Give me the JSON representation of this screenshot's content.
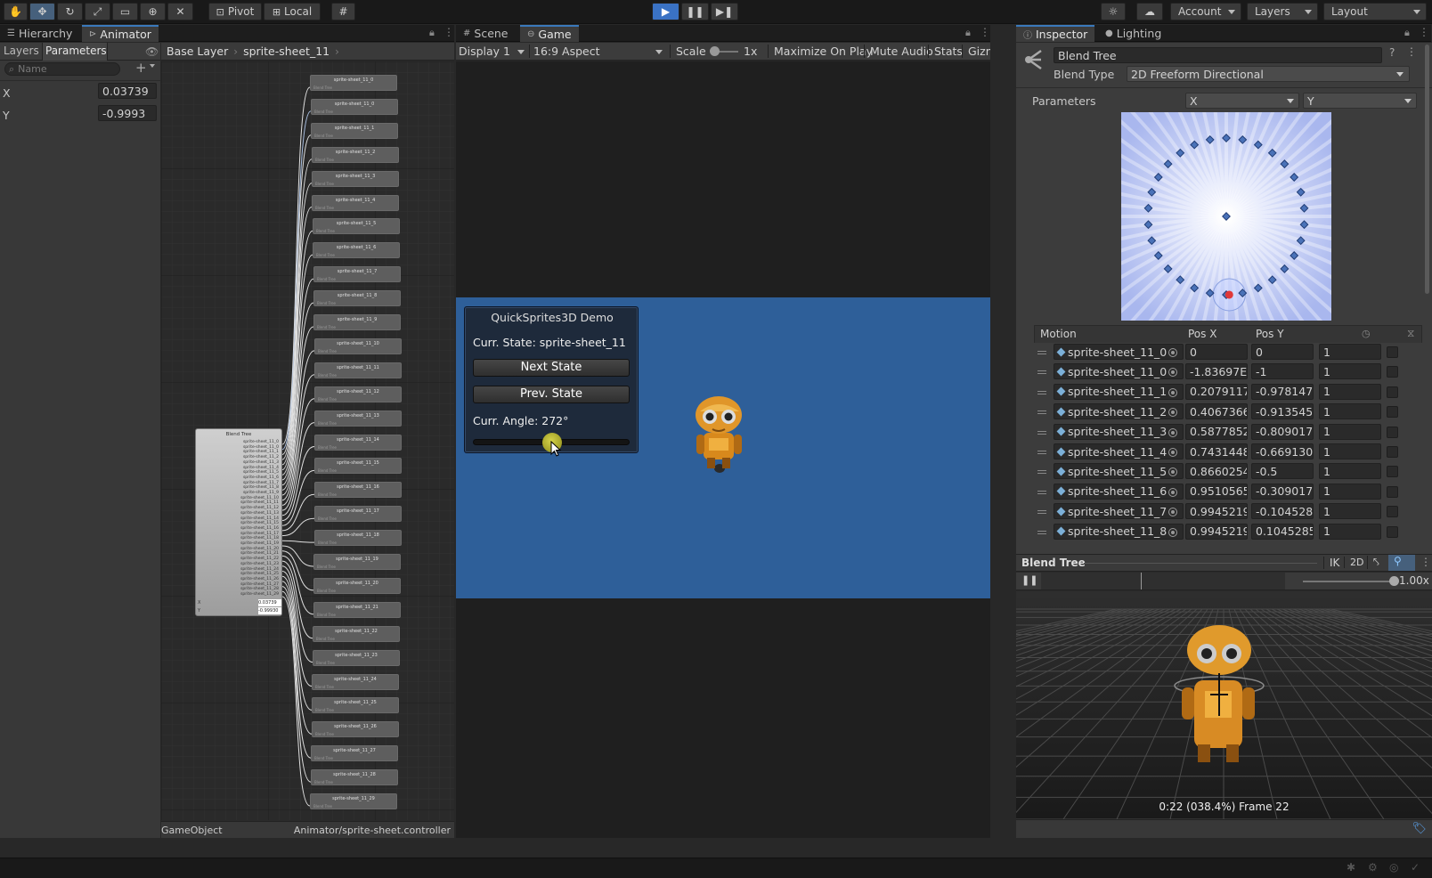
{
  "toolbar": {
    "pivot": "Pivot",
    "local": "Local",
    "account": "Account",
    "layers": "Layers",
    "layout": "Layout"
  },
  "animator": {
    "tabs": [
      "Hierarchy",
      "Animator"
    ],
    "subtabs": [
      "Layers",
      "Parameters"
    ],
    "search_placeholder": "Name",
    "params": [
      {
        "name": "X",
        "value": "0.03739"
      },
      {
        "name": "Y",
        "value": "-0.9993"
      }
    ],
    "breadcrumb": [
      "Base Layer",
      "sprite-sheet_11"
    ],
    "status_left": "GameObject",
    "status_right": "Animator/sprite-sheet.controller",
    "blend_tree_title": "Blend Tree",
    "blend_tree_x_val": "0.03739",
    "blend_tree_y_val": "-0.99930",
    "nodes": [
      "sprite-sheet_11_0",
      "sprite-sheet_11_0",
      "sprite-sheet_11_1",
      "sprite-sheet_11_2",
      "sprite-sheet_11_3",
      "sprite-sheet_11_4",
      "sprite-sheet_11_5",
      "sprite-sheet_11_6",
      "sprite-sheet_11_7",
      "sprite-sheet_11_8",
      "sprite-sheet_11_9",
      "sprite-sheet_11_10",
      "sprite-sheet_11_11",
      "sprite-sheet_11_12",
      "sprite-sheet_11_13",
      "sprite-sheet_11_14",
      "sprite-sheet_11_15",
      "sprite-sheet_11_16",
      "sprite-sheet_11_17",
      "sprite-sheet_11_18",
      "sprite-sheet_11_19",
      "sprite-sheet_11_20",
      "sprite-sheet_11_21",
      "sprite-sheet_11_22",
      "sprite-sheet_11_23",
      "sprite-sheet_11_24",
      "sprite-sheet_11_25",
      "sprite-sheet_11_26",
      "sprite-sheet_11_27",
      "sprite-sheet_11_28",
      "sprite-sheet_11_29"
    ],
    "node_sub": "Blend Tree"
  },
  "game": {
    "tabs": [
      "Scene",
      "Game"
    ],
    "display": "Display 1",
    "aspect": "16:9 Aspect",
    "scale_label": "Scale",
    "scale_value": "1x",
    "maximize": "Maximize On Play",
    "mute": "Mute Audio",
    "stats": "Stats",
    "gizmos": "Gizm",
    "demo_title": "QuickSprites3D Demo",
    "curr_state": "Curr. State: sprite-sheet_11",
    "next_btn": "Next State",
    "prev_btn": "Prev. State",
    "curr_angle": "Curr. Angle: 272°",
    "angle_fraction": 0.5
  },
  "inspector": {
    "tabs": [
      "Inspector",
      "Lighting"
    ],
    "name": "Blend Tree",
    "blend_type_label": "Blend Type",
    "blend_type": "2D Freeform Directional",
    "parameters_label": "Parameters",
    "param_x": "X",
    "param_y": "Y",
    "table_headers": [
      "Motion",
      "Pos X",
      "Pos Y"
    ],
    "motions": [
      {
        "motion": "sprite-sheet_11_0",
        "px": "0",
        "py": "0",
        "t": "1"
      },
      {
        "motion": "sprite-sheet_11_0",
        "px": "-1.83697E-",
        "py": "-1",
        "t": "1"
      },
      {
        "motion": "sprite-sheet_11_1",
        "px": "0.2079117",
        "py": "-0.9781476",
        "t": "1"
      },
      {
        "motion": "sprite-sheet_11_2",
        "px": "0.4067366",
        "py": "-0.9135454",
        "t": "1"
      },
      {
        "motion": "sprite-sheet_11_3",
        "px": "0.5877852",
        "py": "-0.809017",
        "t": "1"
      },
      {
        "motion": "sprite-sheet_11_4",
        "px": "0.7431448",
        "py": "-0.6691306",
        "t": "1"
      },
      {
        "motion": "sprite-sheet_11_5",
        "px": "0.8660254",
        "py": "-0.5",
        "t": "1"
      },
      {
        "motion": "sprite-sheet_11_6",
        "px": "0.9510565",
        "py": "-0.309017",
        "t": "1"
      },
      {
        "motion": "sprite-sheet_11_7",
        "px": "0.9945219",
        "py": "-0.1045285",
        "t": "1"
      },
      {
        "motion": "sprite-sheet_11_8",
        "px": "0.9945219",
        "py": "0.1045285",
        "t": "1"
      }
    ],
    "preview_title": "Blend Tree",
    "ik": "IK",
    "twod": "2D",
    "speed": "1.00x",
    "speed_fraction": 0.5,
    "frame_info": "0:22 (038.4%) Frame 22"
  },
  "colors": {
    "accent": "#3a79bb",
    "game_blue": "#2e5f99",
    "slider_knob": "#b7b52a"
  }
}
